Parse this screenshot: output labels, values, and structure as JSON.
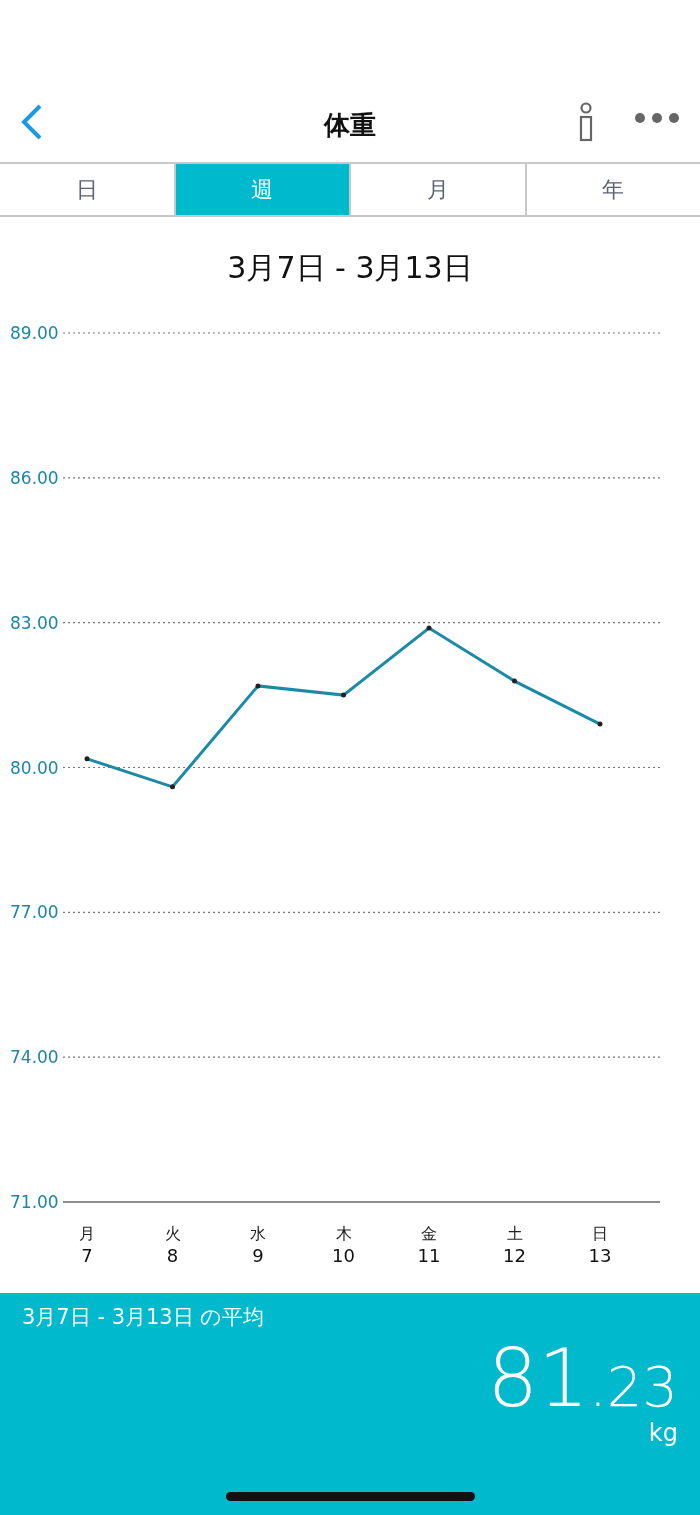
{
  "header": {
    "title": "体重"
  },
  "tabs": [
    {
      "label": "日",
      "selected": false
    },
    {
      "label": "週",
      "selected": true
    },
    {
      "label": "月",
      "selected": false
    },
    {
      "label": "年",
      "selected": false
    }
  ],
  "period": "3月7日 - 3月13日",
  "chart_data": {
    "type": "line",
    "categories": [
      {
        "weekday": "月",
        "day": "7"
      },
      {
        "weekday": "火",
        "day": "8"
      },
      {
        "weekday": "水",
        "day": "9"
      },
      {
        "weekday": "木",
        "day": "10"
      },
      {
        "weekday": "金",
        "day": "11"
      },
      {
        "weekday": "土",
        "day": "12"
      },
      {
        "weekday": "日",
        "day": "13"
      }
    ],
    "grid": true,
    "series": [
      {
        "color": "#1a8aa6",
        "values": [
          80.18,
          79.6,
          81.69,
          81.5,
          82.89,
          81.79,
          80.9
        ]
      }
    ],
    "ylim": [
      71,
      89
    ],
    "yticks": [
      {
        "value": 89,
        "label": "89.00"
      },
      {
        "value": 86,
        "label": "86.00"
      },
      {
        "value": 83,
        "label": "83.00"
      },
      {
        "value": 80,
        "label": "80.00"
      },
      {
        "value": 77,
        "label": "77.00"
      },
      {
        "value": 74,
        "label": "74.00"
      },
      {
        "value": 71,
        "label": "71.00"
      }
    ]
  },
  "average": {
    "label": "3月7日 - 3月13日 の平均",
    "value_integer": "81",
    "value_decimal": ".23",
    "unit": "kg"
  }
}
